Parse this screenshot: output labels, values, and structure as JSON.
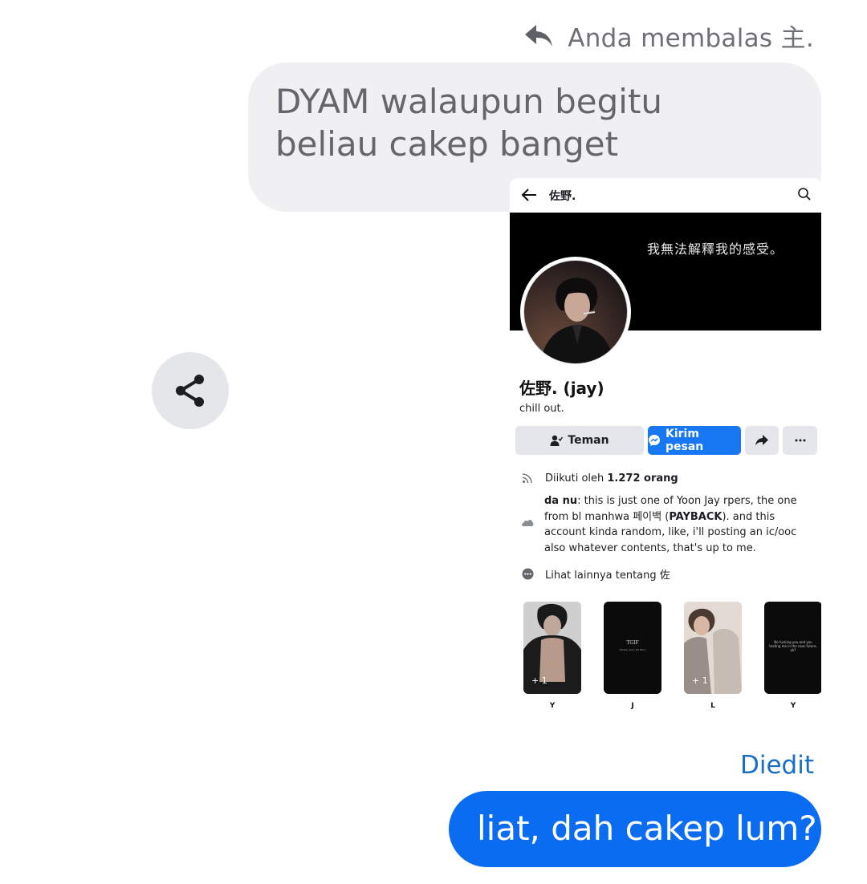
{
  "reply": {
    "icon": "reply-arrow-icon",
    "text": "Anda membalas 主."
  },
  "messages": {
    "incoming_text": "DYAM walaupun begitu beliau cakep banget",
    "edited_label": "Diedit",
    "outgoing_text": "liat, dah cakep lum?"
  },
  "share_button": {
    "icon": "share-icon"
  },
  "screenshot": {
    "header_title": "佐野.",
    "cover_text": "我無法解釋我的感受。",
    "profile_name": "佐野. (jay)",
    "bio": "chill out.",
    "buttons": {
      "friends": "Teman",
      "message": "Kirim pesan"
    },
    "followers_prefix": "Diikuti oleh ",
    "followers_count": "1.272 orang",
    "about": {
      "author": "da nu",
      "text_1": ": this is just one of Yoon Jay rpers, the one from bl manhwa 페이백 (",
      "bold": "PAYBACK",
      "text_2": "). and this account kinda random, like, i'll posting an ic/ooc also whatever contents, that's up to me."
    },
    "see_more": "Lihat lainnya tentang 佐",
    "photos": [
      {
        "label": "Y",
        "count": "+ 1"
      },
      {
        "label": "J",
        "caption": "TGIF",
        "sub": "(Thank, God, It's Fan!)"
      },
      {
        "label": "L",
        "count": "+ 1"
      },
      {
        "label": "Y",
        "caption": "No fucking you and you texting me in the near future, ok?"
      }
    ]
  },
  "colors": {
    "accent_blue": "#0a6cf0",
    "messenger_blue": "#1877f2",
    "bubble_gray": "#f0f0f3",
    "edited_blue": "#1a6fc4"
  }
}
